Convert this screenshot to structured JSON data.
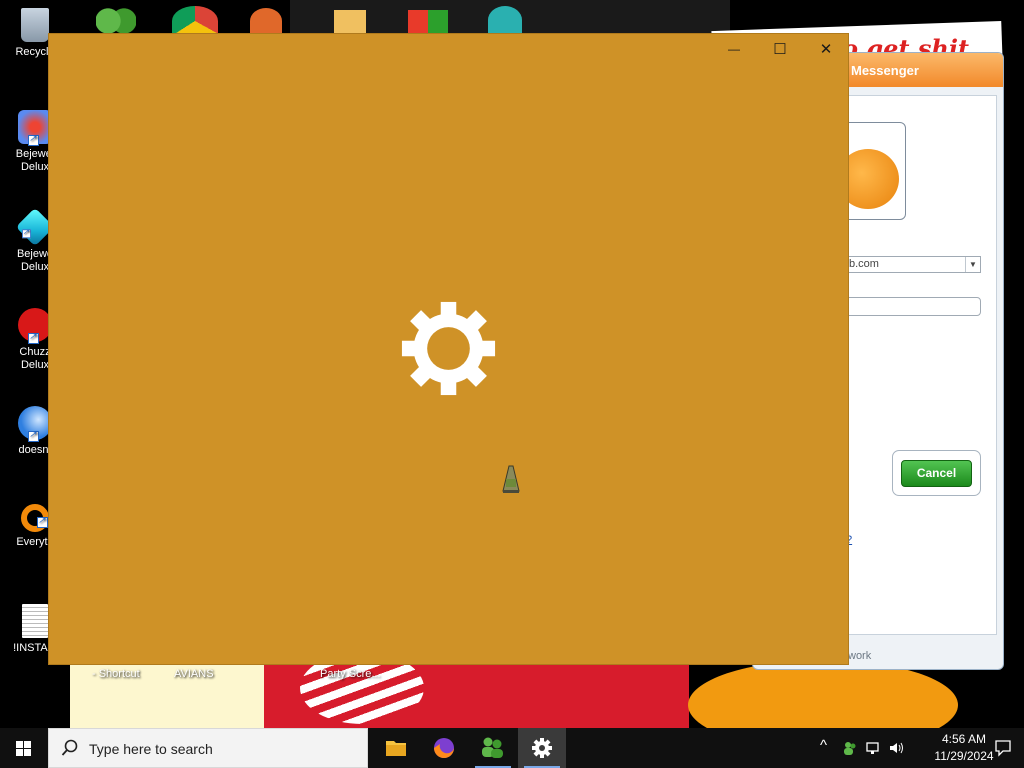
{
  "desktop": {
    "icons": [
      {
        "label": "Recycle"
      },
      {
        "label": "Bejewel\nDelux"
      },
      {
        "label": "Bejewe\nDelux"
      },
      {
        "label": "Chuzz\nDelux"
      },
      {
        "label": "doesnt"
      },
      {
        "label": "Everyth"
      },
      {
        "label": "!INSTALI"
      }
    ],
    "bottom_labels": {
      "shortcut": "- Shortcut",
      "avians": "AVIANS",
      "party": "Party Scre..."
    },
    "wallpaper_text": "o get shit"
  },
  "messenger": {
    "title": "Messenger",
    "account_value": "b.com",
    "cancel_label": "Cancel",
    "help_link": "?",
    "status": "work"
  },
  "settings_window": {
    "background_color": "#cf9227",
    "controls": {
      "minimize": "—",
      "maximize": "☐",
      "close": "✕"
    }
  },
  "taskbar": {
    "search_placeholder": "Type here to search",
    "clock_time": "4:56 AM",
    "clock_date": "11/29/2024",
    "tray_chevron": "^"
  }
}
